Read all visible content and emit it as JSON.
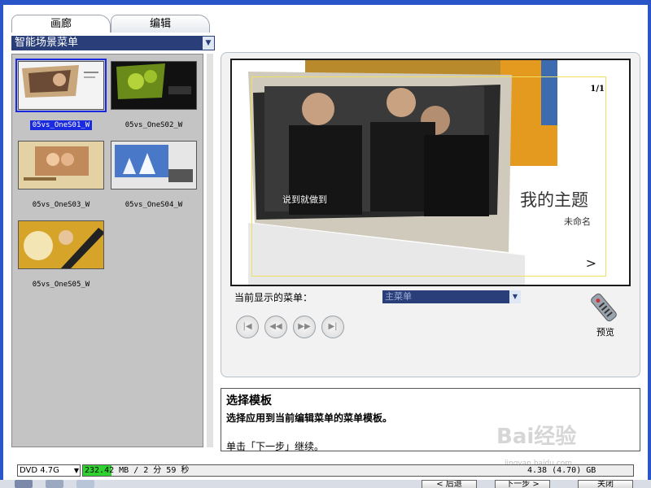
{
  "tabs": [
    {
      "label": "画廊",
      "active": true
    },
    {
      "label": "编辑",
      "active": false
    }
  ],
  "menu_type_select": {
    "value": "智能场景菜单"
  },
  "templates": [
    {
      "name": "05vs_OneS01_W",
      "selected": true
    },
    {
      "name": "05vs_OneS02_W",
      "selected": false
    },
    {
      "name": "05vs_OneS03_W",
      "selected": false
    },
    {
      "name": "05vs_OneS04_W",
      "selected": false
    },
    {
      "name": "05vs_OneS05_W",
      "selected": false
    }
  ],
  "preview": {
    "page_num": "1/1",
    "theme_title": "我的主题",
    "theme_subtitle": "未命名",
    "photo_caption": "说到就做到",
    "next_arrow": ">"
  },
  "current_menu": {
    "label": "当前显示的菜单：",
    "value": "主菜单"
  },
  "nav_buttons": [
    {
      "name": "first-icon",
      "glyph": "|◀"
    },
    {
      "name": "rewind-icon",
      "glyph": "◀◀"
    },
    {
      "name": "fast-forward-icon",
      "glyph": "▶▶"
    },
    {
      "name": "last-icon",
      "glyph": "▶|"
    }
  ],
  "preview_button": {
    "label": "预览",
    "icon": "remote-control-icon"
  },
  "info": {
    "title": "选择模板",
    "description": "选择应用到当前编辑菜单的菜单模板。",
    "hint": "单击「下一步」继续。"
  },
  "status": {
    "disc_type": "DVD 4.7G",
    "used": "232.42 MB /  2 分 59 秒",
    "total": "4.38 (4.70) GB",
    "fill_fraction": 0.052
  },
  "footer": {
    "buttons": [
      "< 后退",
      "下一步 >",
      "关闭"
    ]
  },
  "watermark": {
    "text": "Bai经验",
    "sub": "jingyan.baidu.com"
  },
  "colors": {
    "accent": "#2a3f7a",
    "selection": "#1a2adf",
    "frame": "#2a55c8",
    "capacity": "#2fd12f"
  }
}
